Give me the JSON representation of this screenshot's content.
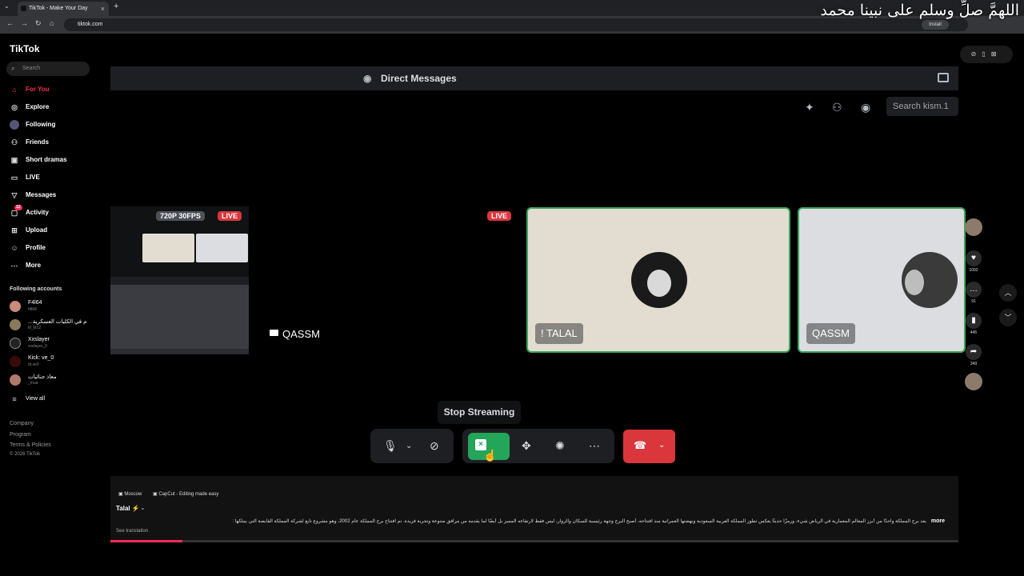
{
  "browser": {
    "tab_title": "TikTok - Make Your Day",
    "url": "tiktok.com",
    "install_label": "Install"
  },
  "overlay_text": "اللهمَّ صلِّ وسلم على نبينا محمد",
  "sidebar": {
    "logo": "TikTok",
    "search_placeholder": "Search",
    "nav": [
      {
        "label": "For You",
        "icon": "home-icon"
      },
      {
        "label": "Explore",
        "icon": "compass-icon"
      },
      {
        "label": "Following",
        "icon": "following-icon"
      },
      {
        "label": "Friends",
        "icon": "friends-icon"
      },
      {
        "label": "Short dramas",
        "icon": "film-icon"
      },
      {
        "label": "LIVE",
        "icon": "live-icon"
      },
      {
        "label": "Messages",
        "icon": "messages-icon"
      },
      {
        "label": "Activity",
        "icon": "activity-icon",
        "badge": "12"
      },
      {
        "label": "Upload",
        "icon": "upload-icon"
      },
      {
        "label": "Profile",
        "icon": "profile-icon"
      },
      {
        "label": "More",
        "icon": "more-icon"
      }
    ],
    "following_title": "Following accounts",
    "accounts": [
      {
        "name": "F4l64",
        "handle": "f4l64"
      },
      {
        "name": "...م في الكليات العسكرية",
        "handle": "kf_kf12"
      },
      {
        "name": "Xxslayer",
        "handle": "xxslayer_0"
      },
      {
        "name": "Kick: ve_0",
        "handle": "dr.ve0"
      },
      {
        "name": "معاذ جنائيات",
        "handle": "_mua"
      }
    ],
    "view_all": "View all",
    "footer": [
      "Company",
      "Program",
      "Terms & Policies",
      "© 2026 TikTok"
    ]
  },
  "discord": {
    "header_title": "Direct Messages",
    "search_placeholder": "Search kism.1",
    "stream_badge": "720P 30FPS",
    "live_badge": "LIVE",
    "streamer_label": "QASSM",
    "tiles": [
      {
        "name": "! TALAL"
      },
      {
        "name": "QASSM"
      }
    ],
    "tooltip": "Stop Streaming"
  },
  "video_caption": {
    "music_1": "Moscow",
    "music_2": "CapCut - Editing made easy",
    "author": "Talal",
    "description": "يعد برج المملكة واحدًا من أبرز المعالم المعمارية في الرياض شيء، ورمزًا حديثًا يعكس تطور المملكة العربية السعودية ونهضتها العمرانية منذ افتتاحه، أصبح البرج وجهة رئيسية للسكان والزوار، ليس فقط لارتفاعه المميز بل أيضًا لما يقدمه من مرافق متنوعة وتجربة فريدة. تم افتتاح برج المملكة عام 2002، وهو مشروع تابع لشركة المملكة القابضة التي يملكها :",
    "more": "more",
    "see_translation": "See translation",
    "progress": 0.085
  },
  "rail": {
    "likes": "1092",
    "comments": "91",
    "saves": "445",
    "shares": "349"
  },
  "colors": {
    "tiktok_red": "#fe2c55",
    "discord_green": "#23a55a",
    "discord_red": "#da373c",
    "discord_bg": "#1e1f22"
  }
}
